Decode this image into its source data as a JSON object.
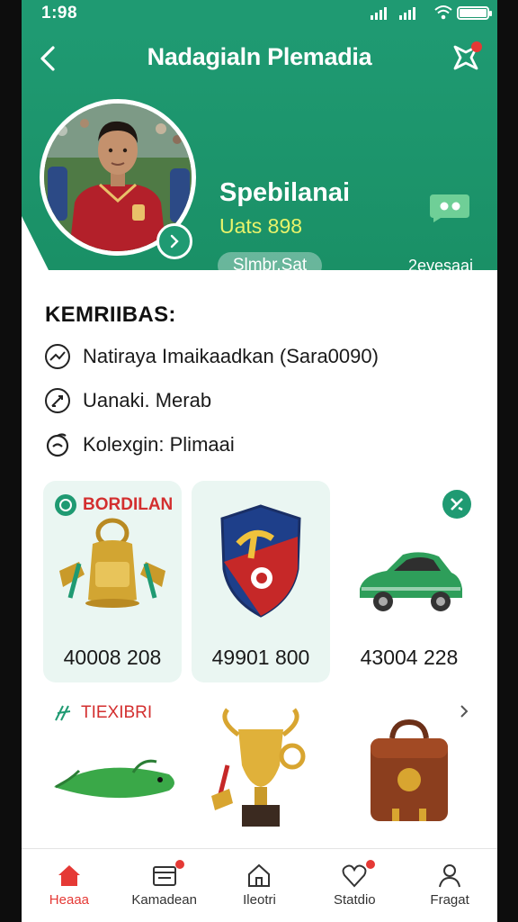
{
  "status_bar": {
    "time": "1:98"
  },
  "header": {
    "title": "Nadagialn Plemadia",
    "back_icon": "chevron-left-icon",
    "menu_icon": "people-share-icon"
  },
  "profile": {
    "name": "Spebilanai",
    "subtitle": "Uats 898",
    "status_chip": "Slmbr.Sat",
    "side_text": "2eyesaai"
  },
  "info": {
    "title": "KEMRIIBAS:",
    "rows": [
      {
        "icon": "trend-icon",
        "text": "Natiraya Imaikaadkan (Sara0090)"
      },
      {
        "icon": "pen-icon",
        "text": "Uanaki. Merab"
      },
      {
        "icon": "collection-icon",
        "text": "Kolexgin: Plimaai"
      }
    ]
  },
  "cards": [
    {
      "label": "BORDILAN",
      "price": "40008 208",
      "icon": "bell-icon"
    },
    {
      "label": "",
      "price": "49901 800",
      "icon": "shield-crest-icon"
    },
    {
      "label": "",
      "price": "43004 228",
      "icon": "car-icon"
    }
  ],
  "second_row": {
    "label": "TIEXIBRI",
    "items": [
      {
        "icon": "fish-icon"
      },
      {
        "icon": "trophy-icon"
      },
      {
        "icon": "bag-icon"
      }
    ]
  },
  "bottom_nav": [
    {
      "label": "Heaaa",
      "icon": "home-icon",
      "active": true
    },
    {
      "label": "Kamadean",
      "icon": "inbox-icon"
    },
    {
      "label": "Ileotri",
      "icon": "house-icon"
    },
    {
      "label": "Statdio",
      "icon": "heart-icon"
    },
    {
      "label": "Fragat",
      "icon": "user-icon"
    }
  ],
  "colors": {
    "primary": "#1f9a72",
    "accent": "#e53935",
    "highlight": "#e8f36a"
  }
}
